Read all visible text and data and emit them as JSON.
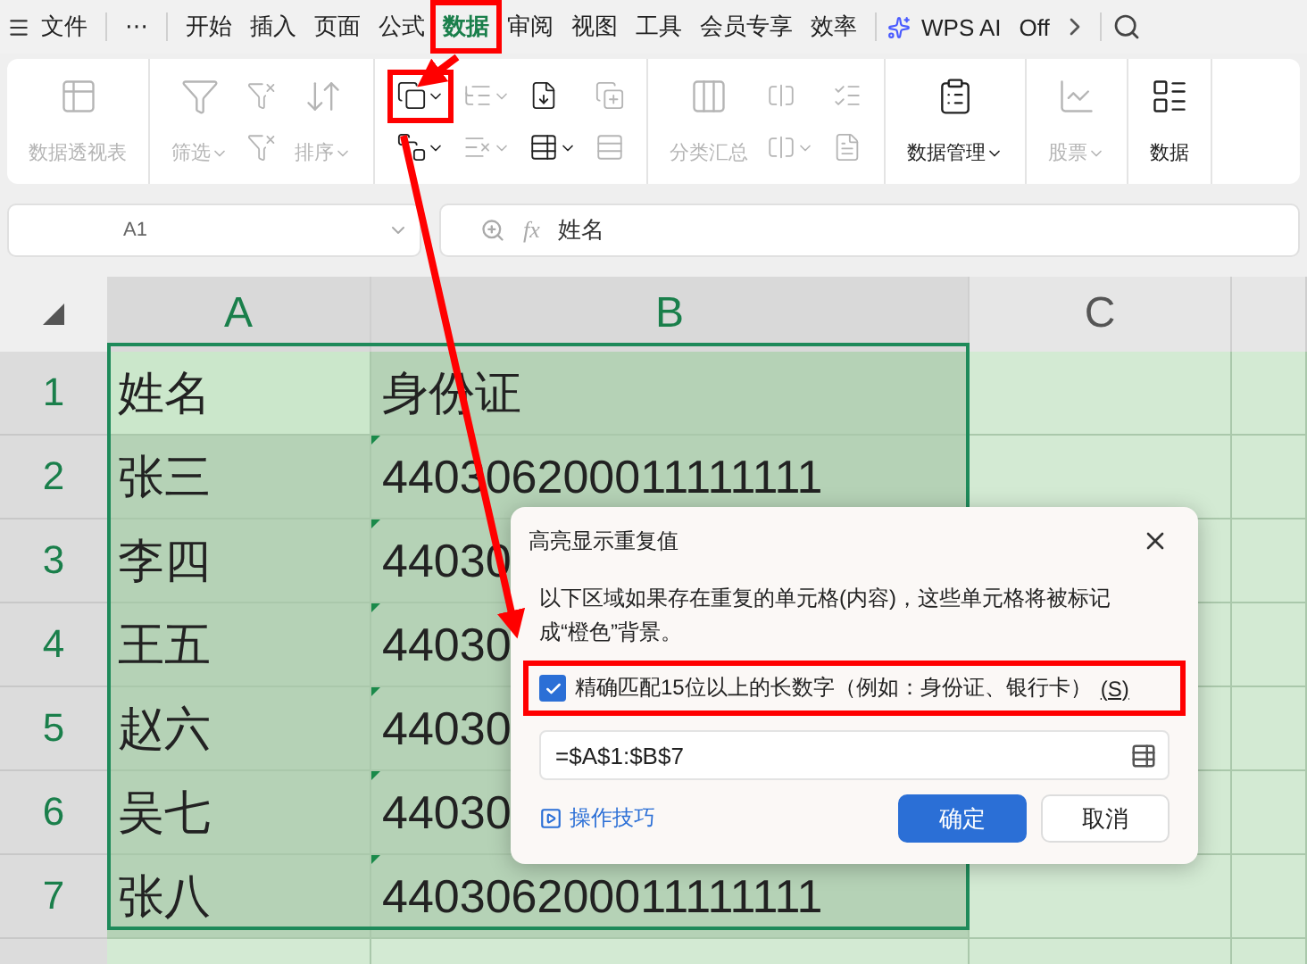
{
  "menu": {
    "items": [
      {
        "label": "文件",
        "selected": false
      },
      {
        "label": "⋯",
        "selected": false
      },
      {
        "label": "开始",
        "selected": false
      },
      {
        "label": "插入",
        "selected": false
      },
      {
        "label": "页面",
        "selected": false
      },
      {
        "label": "公式",
        "selected": false
      },
      {
        "label": "数据",
        "selected": true,
        "annotated": true
      },
      {
        "label": "审阅",
        "selected": false
      },
      {
        "label": "视图",
        "selected": false
      },
      {
        "label": "工具",
        "selected": false
      },
      {
        "label": "会员专享",
        "selected": false
      },
      {
        "label": "效率",
        "selected": false
      },
      {
        "label": "WPS AI",
        "selected": false
      },
      {
        "label": "Off",
        "selected": false
      }
    ]
  },
  "ribbon": {
    "groups": [
      {
        "columns": [
          {
            "kind": "large",
            "label": "数据透视表",
            "disabled": true,
            "dropdown": false
          }
        ]
      },
      {
        "columns": [
          {
            "kind": "large",
            "label": "筛选",
            "disabled": true,
            "dropdown": true
          },
          {
            "kind": "stack",
            "items": [
              {
                "disabled": true,
                "dropdown": false
              },
              {
                "disabled": true,
                "dropdown": false
              }
            ]
          },
          {
            "kind": "large",
            "label": "排序",
            "disabled": true,
            "dropdown": true
          }
        ]
      },
      {
        "columns": [
          {
            "kind": "stack",
            "items": [
              {
                "disabled": false,
                "dropdown": true,
                "annotated": true
              },
              {
                "disabled": false,
                "dropdown": true
              }
            ]
          },
          {
            "kind": "stack",
            "items": [
              {
                "disabled": true,
                "dropdown": true
              },
              {
                "disabled": true,
                "dropdown": true
              }
            ]
          },
          {
            "kind": "stack",
            "items": [
              {
                "disabled": false,
                "dropdown": false
              },
              {
                "disabled": false,
                "dropdown": true
              }
            ]
          },
          {
            "kind": "stack",
            "items": [
              {
                "disabled": true,
                "dropdown": false
              },
              {
                "disabled": true,
                "dropdown": false
              }
            ]
          }
        ]
      },
      {
        "columns": [
          {
            "kind": "large",
            "label": "分类汇总",
            "disabled": true,
            "dropdown": false
          },
          {
            "kind": "stack",
            "items": [
              {
                "disabled": true,
                "dropdown": false
              },
              {
                "disabled": true,
                "dropdown": true
              }
            ]
          },
          {
            "kind": "stack",
            "items": [
              {
                "disabled": true,
                "dropdown": false
              },
              {
                "disabled": true,
                "dropdown": false
              }
            ]
          }
        ]
      },
      {
        "columns": [
          {
            "kind": "large",
            "label": "数据管理",
            "disabled": false,
            "dropdown": true
          }
        ]
      },
      {
        "columns": [
          {
            "kind": "large",
            "label": "股票",
            "disabled": true,
            "dropdown": true
          }
        ]
      },
      {
        "columns": [
          {
            "kind": "large",
            "label": "数据",
            "disabled": false,
            "dropdown": false
          }
        ]
      }
    ]
  },
  "formula_bar": {
    "cell_reference": "A1",
    "function_label": "fx",
    "formula": "姓名"
  },
  "sheet": {
    "columns": [
      {
        "label": "A",
        "selected": true
      },
      {
        "label": "B",
        "selected": true
      },
      {
        "label": "C",
        "selected": false
      }
    ],
    "rows": [
      {
        "number": "1",
        "cells": [
          "姓名",
          "身份证"
        ]
      },
      {
        "number": "2",
        "cells": [
          "张三",
          "440306200011111111"
        ]
      },
      {
        "number": "3",
        "cells": [
          "李四",
          "44030"
        ]
      },
      {
        "number": "4",
        "cells": [
          "王五",
          "44030"
        ]
      },
      {
        "number": "5",
        "cells": [
          "赵六",
          "44030"
        ]
      },
      {
        "number": "6",
        "cells": [
          "吴七",
          "44030"
        ]
      },
      {
        "number": "7",
        "cells": [
          "张八",
          "440306200011111111"
        ]
      }
    ]
  },
  "dialog": {
    "title": "高亮显示重复值",
    "description": "以下区域如果存在重复的单元格(内容)，这些单元格将被标记成“橙色”背景。",
    "option": {
      "label": "精确匹配15位以上的长数字（例如：身份证、银行卡）",
      "shortcut": "(S)",
      "checked": true,
      "annotated": true
    },
    "range": "=$A$1:$B$7",
    "tips_link": "操作技巧",
    "buttons": [
      {
        "label": "确定",
        "kind": "primary"
      },
      {
        "label": "取消",
        "kind": "secondary"
      }
    ]
  }
}
